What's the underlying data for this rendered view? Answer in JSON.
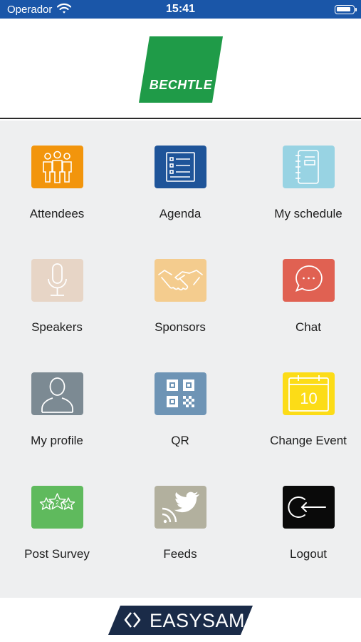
{
  "status_bar": {
    "carrier": "Operador",
    "time": "15:41"
  },
  "header": {
    "logo_text": "BECHTLE"
  },
  "menu": {
    "attendees": "Attendees",
    "agenda": "Agenda",
    "my_schedule": "My schedule",
    "speakers": "Speakers",
    "sponsors": "Sponsors",
    "chat": "Chat",
    "my_profile": "My profile",
    "qr": "QR",
    "change_event": "Change Event",
    "post_survey": "Post Survey",
    "feeds": "Feeds",
    "logout": "Logout",
    "calendar_day": "10",
    "survey_stars": [
      "1",
      "2",
      "3"
    ]
  },
  "colors": {
    "status_bar": "#1a56a8",
    "attendees": "#f2950c",
    "agenda": "#1e5499",
    "my_schedule": "#98d3e3",
    "speakers": "#e7d5c6",
    "sponsors": "#f4cc8e",
    "chat": "#e06152",
    "my_profile": "#7c8a93",
    "qr": "#6e94b5",
    "change_event": "#fcdc17",
    "post_survey": "#5fba5d",
    "feeds": "#b2b09e",
    "logout": "#0a0a0a",
    "logo_green": "#1f9b48",
    "footer_badge": "#1a2b48"
  },
  "footer": {
    "brand": "EASYSAM"
  }
}
